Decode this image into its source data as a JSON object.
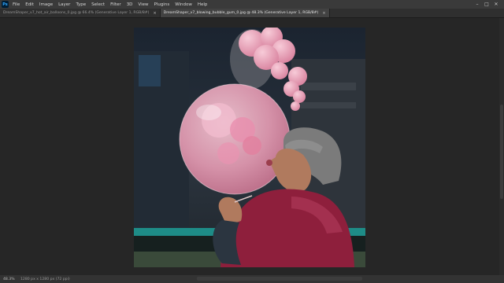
{
  "app": {
    "logo_text": "Ps"
  },
  "menu": [
    "File",
    "Edit",
    "Image",
    "Layer",
    "Type",
    "Select",
    "Filter",
    "3D",
    "View",
    "Plugins",
    "Window",
    "Help"
  ],
  "window_controls": {
    "minimize": "–",
    "maximize": "□",
    "close": "✕"
  },
  "tabs": [
    {
      "label": "DreamShaper_v7_hot_air_balloons_0.jpg @ 66.4% (Generative Layer 1, RGB/8#)",
      "active": false,
      "close": "×"
    },
    {
      "label": "DreamShaper_v7_blowing_bubble_gum_0.jpg @ 48.3% (Generative Layer 1, RGB/8#)",
      "active": true,
      "close": "×"
    }
  ],
  "status": {
    "zoom": "48.3%",
    "info": "1280 px x 1280 px (72 ppi)"
  },
  "colors": {
    "bubble": "#e8a3b8",
    "jacket": "#8e1f3c",
    "beanie": "#7b7b7b",
    "teal_rail": "#1e8c87"
  }
}
